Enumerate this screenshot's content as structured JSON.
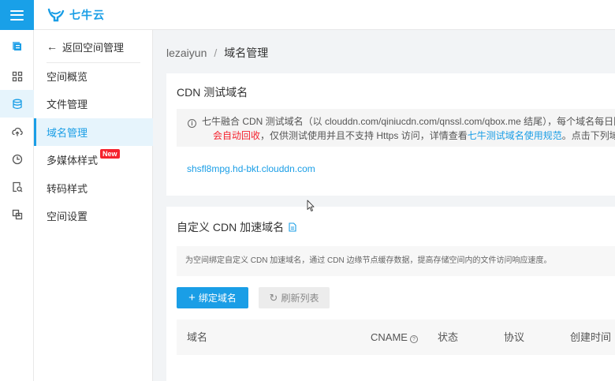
{
  "app": {
    "logo_text": "七牛云",
    "brand_color": "#1a9ee6"
  },
  "rail": {
    "icons": [
      "storage-overview-icon",
      "dashboard-icon",
      "database-icon",
      "cloud-upload-icon",
      "clock-icon",
      "file-search-icon",
      "transfer-icon"
    ]
  },
  "sidebar": {
    "back_label": "返回空间管理",
    "items": [
      {
        "label": "空间概览"
      },
      {
        "label": "文件管理"
      },
      {
        "label": "域名管理"
      },
      {
        "label": "多媒体样式",
        "badge": "New"
      },
      {
        "label": "转码样式"
      },
      {
        "label": "空间设置"
      }
    ]
  },
  "breadcrumb": {
    "root": "lezaiyun",
    "separator": "/",
    "current": "域名管理"
  },
  "test_domain_card": {
    "title": "CDN 测试域名",
    "notice_line1": "七牛融合 CDN 测试域名（以 clouddn.com/qiniucdn.com/qnssl.com/qbox.me 结尾），每个域名每日限",
    "notice_line2_red": "会自动回收",
    "notice_line2_a": "，仅供测试使用并且不支持 Https 访问，详情查看",
    "notice_line2_link": "七牛测试域名使用规范",
    "notice_line2_b": "。点击下列域名可",
    "domain": "shsfl8mpg.hd-bkt.clouddn.com"
  },
  "custom_domain_card": {
    "title": "自定义 CDN 加速域名",
    "description": "为空间绑定自定义 CDN 加速域名，通过 CDN 边缘节点缓存数据，提高存储空间内的文件访问响应速度。",
    "bind_button": "绑定域名",
    "refresh_button": "刷新列表",
    "columns": [
      "域名",
      "CNAME",
      "状态",
      "协议",
      "创建时间"
    ]
  }
}
